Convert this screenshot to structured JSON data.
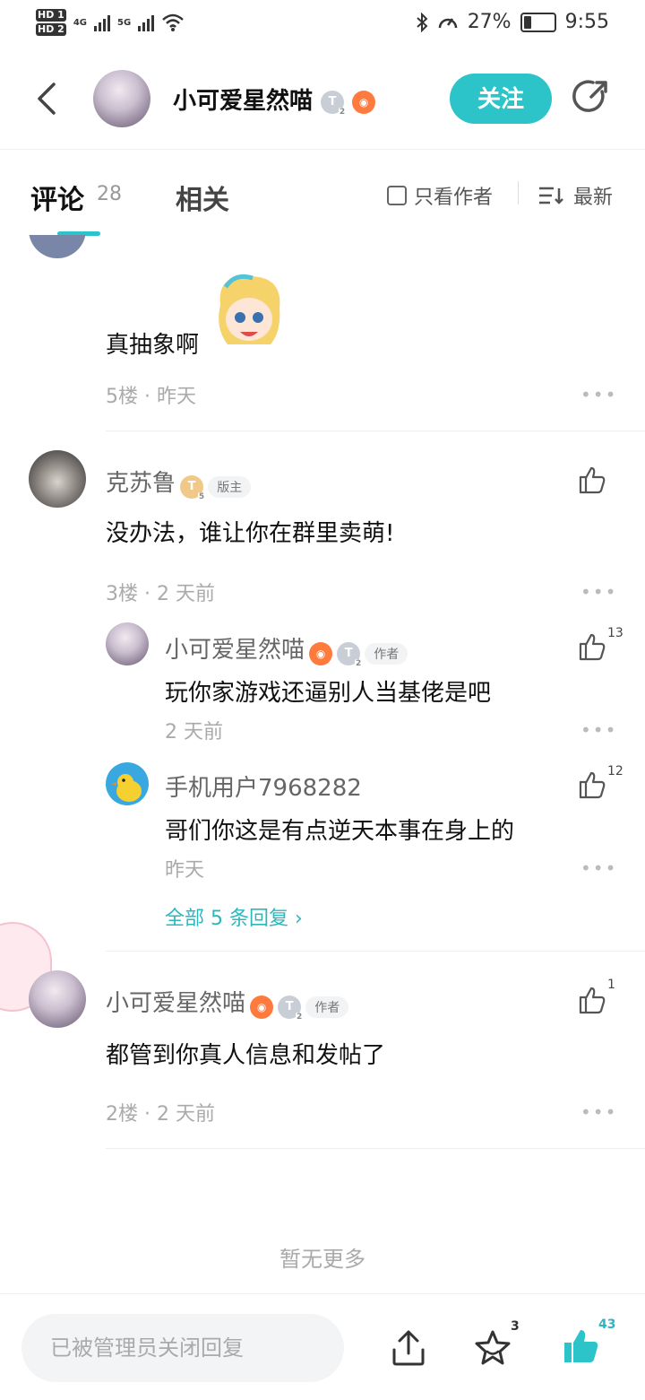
{
  "status_bar": {
    "hd1": "HD 1",
    "hd2": "HD 2",
    "net1": "4G",
    "net2": "5G",
    "battery": "27%",
    "time": "9:55",
    "battery_level": 0.27
  },
  "header": {
    "username": "小可爱星然喵",
    "level": "T",
    "level_num": "2",
    "follow_label": "关注"
  },
  "tabs": {
    "comments_label": "评论",
    "comments_count": "28",
    "related_label": "相关",
    "author_only_label": "只看作者",
    "sort_label": "最新"
  },
  "comments": {
    "partial_top": {
      "content": "真抽象啊",
      "floor": "5楼",
      "time": "昨天"
    },
    "c3": {
      "name": "克苏鲁",
      "level": "T",
      "level_num": "5",
      "tag": "版主",
      "content": "没办法，谁让你在群里卖萌!",
      "floor": "3楼",
      "time": "2 天前",
      "replies": [
        {
          "name": "小可爱星然喵",
          "tag": "作者",
          "content": "玩你家游戏还逼别人当基佬是吧",
          "time": "2 天前",
          "likes": "13",
          "level": "T",
          "level_num": "2"
        },
        {
          "name": "手机用户7968282",
          "content": "哥们你这是有点逆天本事在身上的",
          "time": "昨天",
          "likes": "12"
        }
      ],
      "more_replies": "全部 5 条回复"
    },
    "c2": {
      "name": "小可爱星然喵",
      "tag": "作者",
      "content": "都管到你真人信息和发帖了",
      "floor": "2楼",
      "time": "2 天前",
      "likes": "1",
      "level": "T",
      "level_num": "2"
    },
    "no_more": "暂无更多",
    "dot_sep": "·",
    "more_dots": "•••"
  },
  "bottom": {
    "reply_placeholder": "已被管理员关闭回复",
    "favorites": "3",
    "likes": "43"
  },
  "colors": {
    "accent": "#2cc3c9",
    "game_badge": "#ff7a3d"
  }
}
